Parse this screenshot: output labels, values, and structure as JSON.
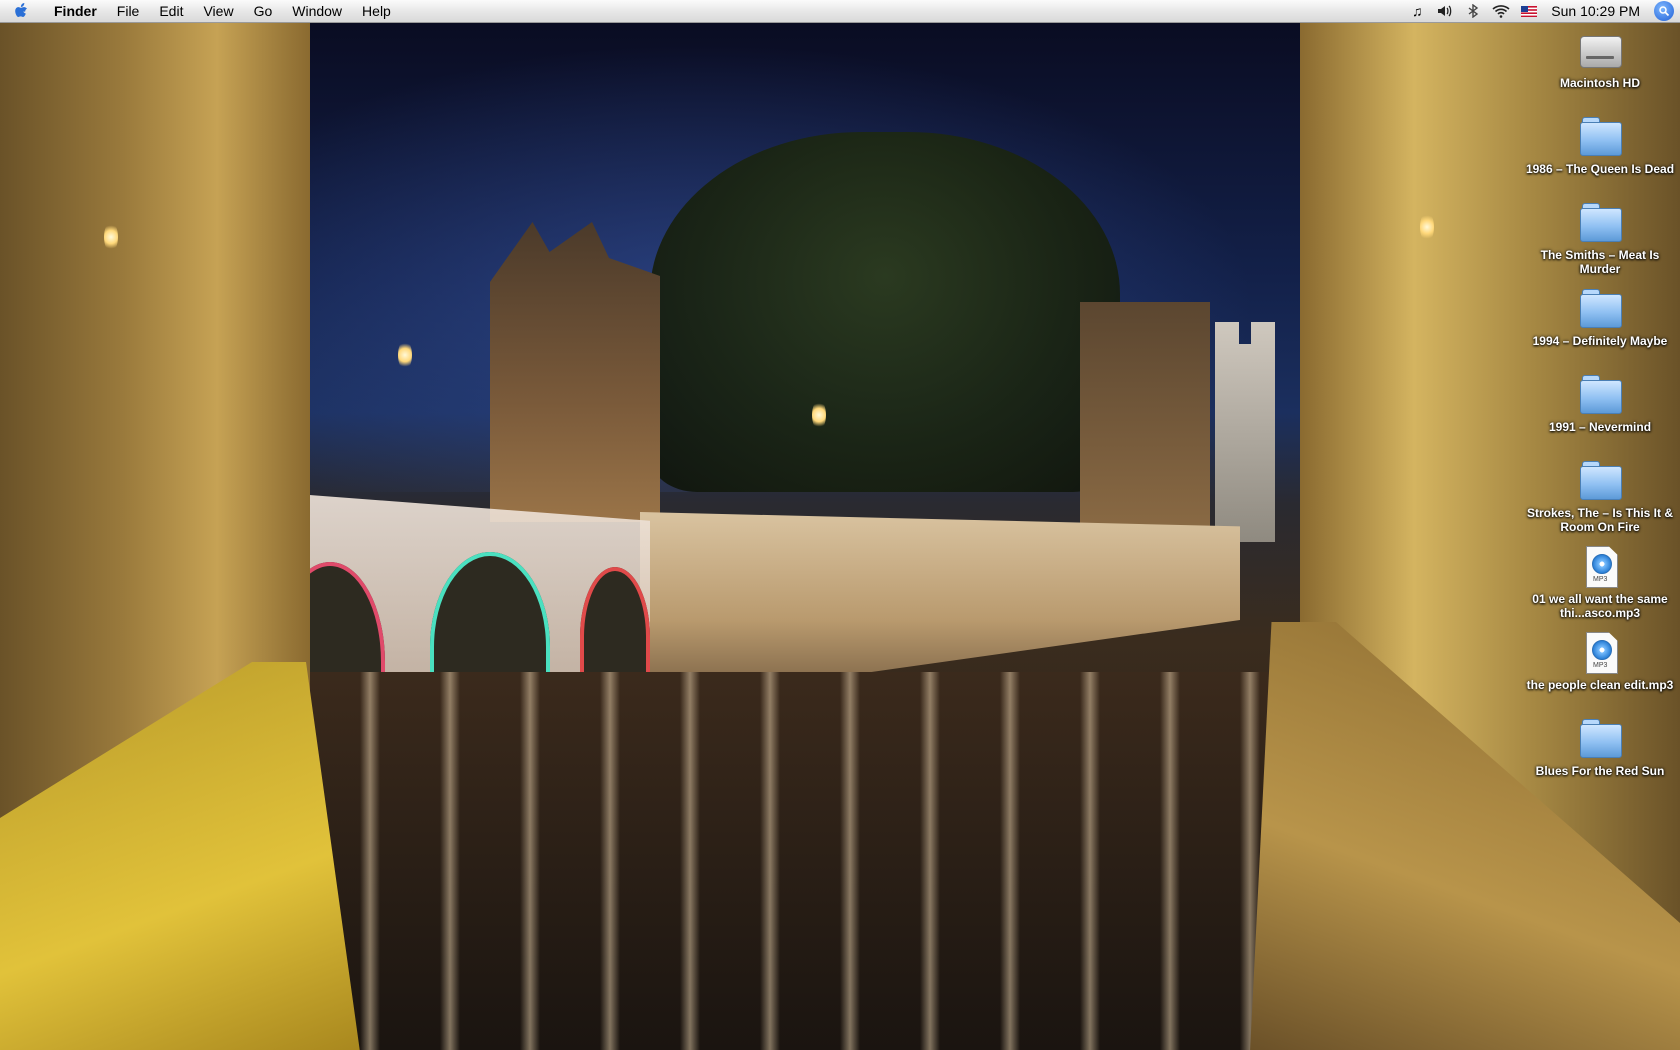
{
  "menubar": {
    "app_name": "Finder",
    "items": [
      "File",
      "Edit",
      "View",
      "Go",
      "Window",
      "Help"
    ],
    "clock": "Sun 10:29 PM",
    "status_icons": [
      "music-note-icon",
      "volume-icon",
      "bluetooth-icon",
      "wifi-icon",
      "us-flag-icon"
    ]
  },
  "desktop": {
    "icons": [
      {
        "label": "Macintosh HD",
        "type": "hard-drive"
      },
      {
        "label": "1986 – The Queen Is Dead",
        "type": "folder"
      },
      {
        "label": "The Smiths – Meat Is Murder",
        "type": "folder"
      },
      {
        "label": "1994 – Definitely Maybe",
        "type": "folder"
      },
      {
        "label": "1991 – Nevermind",
        "type": "folder"
      },
      {
        "label": "Strokes, The – Is This It & Room On Fire",
        "type": "folder"
      },
      {
        "label": "01 we all want the same thi...asco.mp3",
        "type": "mp3"
      },
      {
        "label": "the people clean edit.mp3",
        "type": "mp3"
      },
      {
        "label": "Blues For the Red Sun",
        "type": "folder"
      }
    ],
    "mp3_tag": "MP3"
  }
}
